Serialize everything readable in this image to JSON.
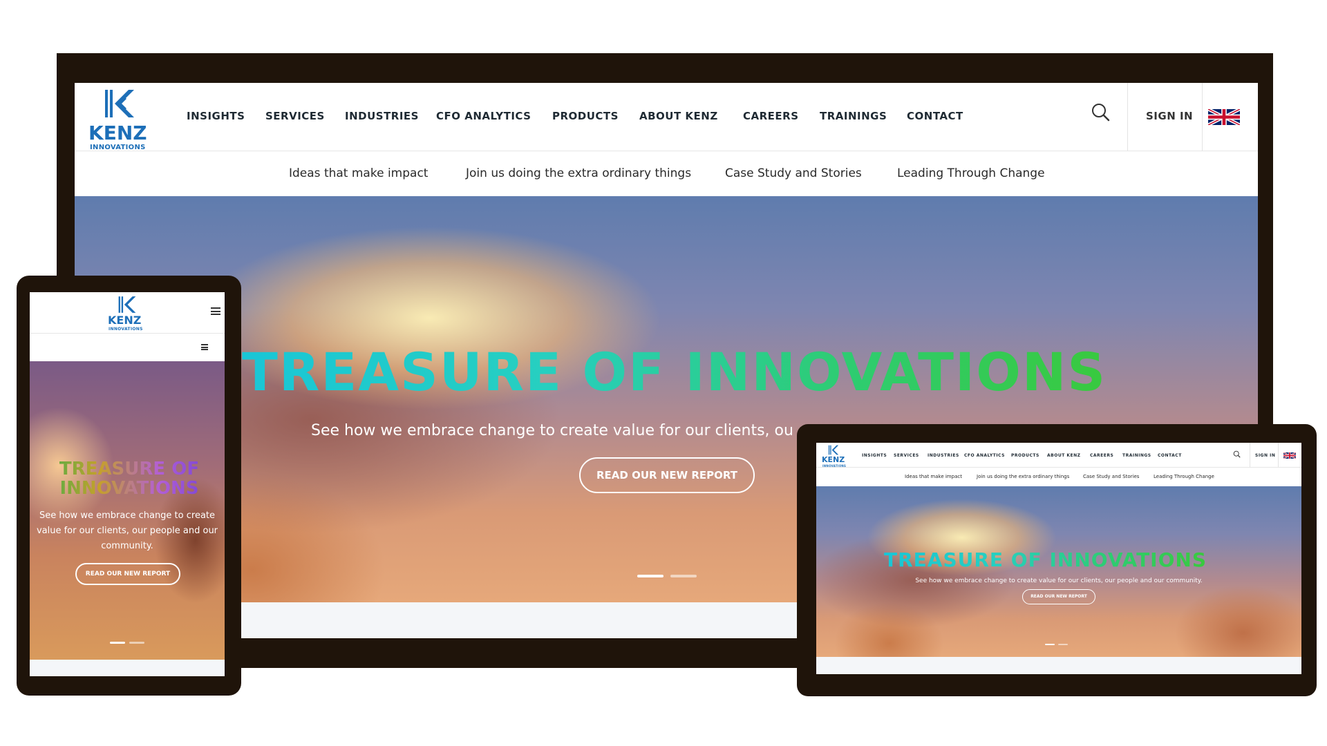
{
  "brand": {
    "name": "KENZ",
    "tagline": "INNOVATIONS"
  },
  "nav": {
    "items": [
      "INSIGHTS",
      "SERVICES",
      "INDUSTRIES",
      "CFO ANALYTICS",
      "PRODUCTS",
      "ABOUT KENZ",
      "CAREERS",
      "TRAININGS",
      "CONTACT"
    ],
    "sign_in": "SIGN IN",
    "search_icon": "search-icon",
    "flag_icon": "uk-flag-icon",
    "menu_icon": "hamburger-icon"
  },
  "subnav": {
    "items": [
      "Ideas that make impact",
      "Join us doing the extra ordinary things",
      "Case Study and Stories",
      "Leading Through Change"
    ]
  },
  "hero": {
    "title_word1": "TREASURE",
    "title_word2": "OF",
    "title_word3": "INNOVATIONS",
    "subtitle": "See how we embrace change to create value for our clients, our people and our community.",
    "subtitle_desktop_visible": "See how we embrace change to create value for our clients, ou",
    "subtitle_mobile_lines": [
      "See how we embrace change to create",
      "value for our clients, our people and our",
      "community."
    ],
    "button": "READ OUR NEW REPORT",
    "slides": 2,
    "active_slide": 1
  },
  "colors": {
    "frame": "#1f140a",
    "brand": "#1d6fb8",
    "title_start": "#19c6d6",
    "title_end": "#39c93e"
  }
}
